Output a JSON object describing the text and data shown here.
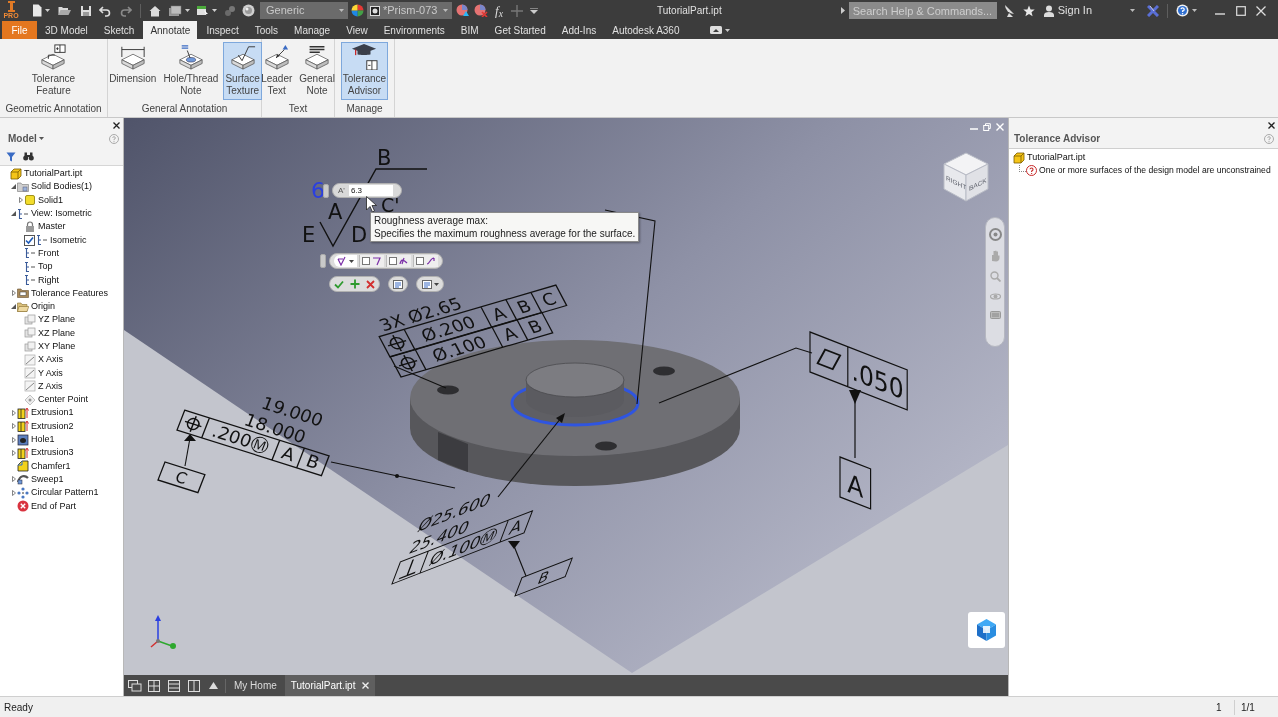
{
  "title_bar": {
    "app_badge": "PRO",
    "material": "Generic",
    "appearance": "*Prism-073",
    "parameters": "f$_{x}$",
    "document_title": "TutorialPart.ipt",
    "search": {
      "placeholder": "Search Help & Commands..."
    },
    "sign_in": "Sign In"
  },
  "tabs": [
    {
      "label": "File",
      "kind": "file",
      "selected": false
    },
    {
      "label": "3D Model",
      "kind": "tab",
      "selected": false
    },
    {
      "label": "Sketch",
      "kind": "tab",
      "selected": false
    },
    {
      "label": "Annotate",
      "kind": "tab",
      "selected": true
    },
    {
      "label": "Inspect",
      "kind": "tab",
      "selected": false
    },
    {
      "label": "Tools",
      "kind": "tab",
      "selected": false
    },
    {
      "label": "Manage",
      "kind": "tab",
      "selected": false
    },
    {
      "label": "View",
      "kind": "tab",
      "selected": false
    },
    {
      "label": "Environments",
      "kind": "tab",
      "selected": false
    },
    {
      "label": "BIM",
      "kind": "tab",
      "selected": false
    },
    {
      "label": "Get Started",
      "kind": "tab",
      "selected": false
    },
    {
      "label": "Add-Ins",
      "kind": "tab",
      "selected": false
    },
    {
      "label": "Autodesk A360",
      "kind": "tab",
      "selected": false
    }
  ],
  "ribbon": [
    {
      "title": "Geometric Annotation",
      "buttons": [
        {
          "label": "Tolerance Feature",
          "kind": "tolerance_feature",
          "selected": false
        }
      ]
    },
    {
      "title": "General Annotation",
      "buttons": [
        {
          "label": "Dimension",
          "kind": "dimension",
          "selected": false
        },
        {
          "label": "Hole/Thread Note",
          "kind": "hole_note",
          "selected": false
        },
        {
          "label": "Surface Texture",
          "kind": "surface_texture",
          "selected": true
        }
      ]
    },
    {
      "title": "Text",
      "buttons": [
        {
          "label": "Leader Text",
          "kind": "leader_text",
          "selected": false
        },
        {
          "label": "General Note",
          "kind": "general_note",
          "selected": false
        }
      ]
    },
    {
      "title": "Manage",
      "buttons": [
        {
          "label": "Tolerance Advisor",
          "kind": "tolerance_advisor",
          "selected": true
        }
      ]
    }
  ],
  "model_browser": {
    "title": "Model",
    "tree": [
      {
        "label": "TutorialPart.ipt",
        "kind": "part",
        "children": [
          {
            "label": "Solid Bodies(1)",
            "kind": "bodies",
            "expanded": true,
            "children": [
              {
                "label": "Solid1",
                "kind": "solid",
                "expanded": false
              }
            ]
          },
          {
            "label": "View: Isometric",
            "kind": "view",
            "expanded": true,
            "children": [
              {
                "label": "Master",
                "kind": "lock"
              },
              {
                "label": "Isometric",
                "kind": "view",
                "checked": true
              },
              {
                "label": "Front",
                "kind": "view"
              },
              {
                "label": "Top",
                "kind": "view"
              },
              {
                "label": "Right",
                "kind": "view"
              }
            ]
          },
          {
            "label": "Tolerance Features",
            "kind": "tolerance_folder",
            "expanded": false
          },
          {
            "label": "Origin",
            "kind": "folder",
            "expanded": true,
            "children": [
              {
                "label": "YZ Plane",
                "kind": "plane"
              },
              {
                "label": "XZ Plane",
                "kind": "plane"
              },
              {
                "label": "XY Plane",
                "kind": "plane"
              },
              {
                "label": "X Axis",
                "kind": "axis"
              },
              {
                "label": "Y Axis",
                "kind": "axis"
              },
              {
                "label": "Z Axis",
                "kind": "axis"
              },
              {
                "label": "Center Point",
                "kind": "point"
              }
            ]
          },
          {
            "label": "Extrusion1",
            "kind": "extrusion",
            "expanded": false
          },
          {
            "label": "Extrusion2",
            "kind": "extrusion",
            "expanded": false
          },
          {
            "label": "Hole1",
            "kind": "hole",
            "expanded": false
          },
          {
            "label": "Extrusion3",
            "kind": "extrusion",
            "expanded": false
          },
          {
            "label": "Chamfer1",
            "kind": "chamfer"
          },
          {
            "label": "Sweep1",
            "kind": "sweep",
            "expanded": false
          },
          {
            "label": "Circular Pattern1",
            "kind": "pattern",
            "expanded": false
          },
          {
            "label": "End of Part",
            "kind": "end"
          }
        ]
      }
    ]
  },
  "viewport": {
    "surface_symbol": [
      "6",
      "B",
      "C'",
      "A",
      "E",
      "D"
    ],
    "value_input": {
      "label": "A'",
      "value": "6.3"
    },
    "tooltip": {
      "title": "Roughness average max:",
      "text": "Specifies the maximum roughness average for the surface."
    },
    "symbol_options": [
      {
        "checked": false
      },
      {
        "checked": false
      },
      {
        "checked": false
      }
    ],
    "notes": [
      "3X Ø2.65",
      "19.000",
      "18.000",
      "Ø25.600",
      "25.400"
    ],
    "frames": [
      {
        "kind": "position",
        "cells": [
          "Ø.200",
          "A",
          "B",
          "C"
        ]
      },
      {
        "kind": "position",
        "cells": [
          "Ø.100",
          "A",
          "B"
        ]
      },
      {
        "kind": "position",
        "cells": [
          ".200Ⓜ",
          "A",
          "B"
        ]
      },
      {
        "kind": "perpendicularity",
        "cells": [
          "Ø.100Ⓜ",
          "A"
        ]
      },
      {
        "kind": "flatness",
        "cells": [
          ".050"
        ]
      }
    ],
    "datums": [
      "C",
      "B",
      "A"
    ],
    "view_cube": [
      "RIGHT",
      "BACK"
    ]
  },
  "tolerance_advisor": {
    "title": "Tolerance Advisor",
    "tree": [
      {
        "label": "TutorialPart.ipt",
        "kind": "part",
        "children": [
          {
            "label": "One or more surfaces of the design model are unconstrained",
            "kind": "question"
          }
        ]
      }
    ]
  },
  "document_tabs": [
    {
      "label": "My Home",
      "selected": false,
      "closable": false
    },
    {
      "label": "TutorialPart.ipt",
      "selected": true,
      "closable": true
    }
  ],
  "status_bar": {
    "message": "Ready",
    "page": "1",
    "pages": "1/1"
  }
}
